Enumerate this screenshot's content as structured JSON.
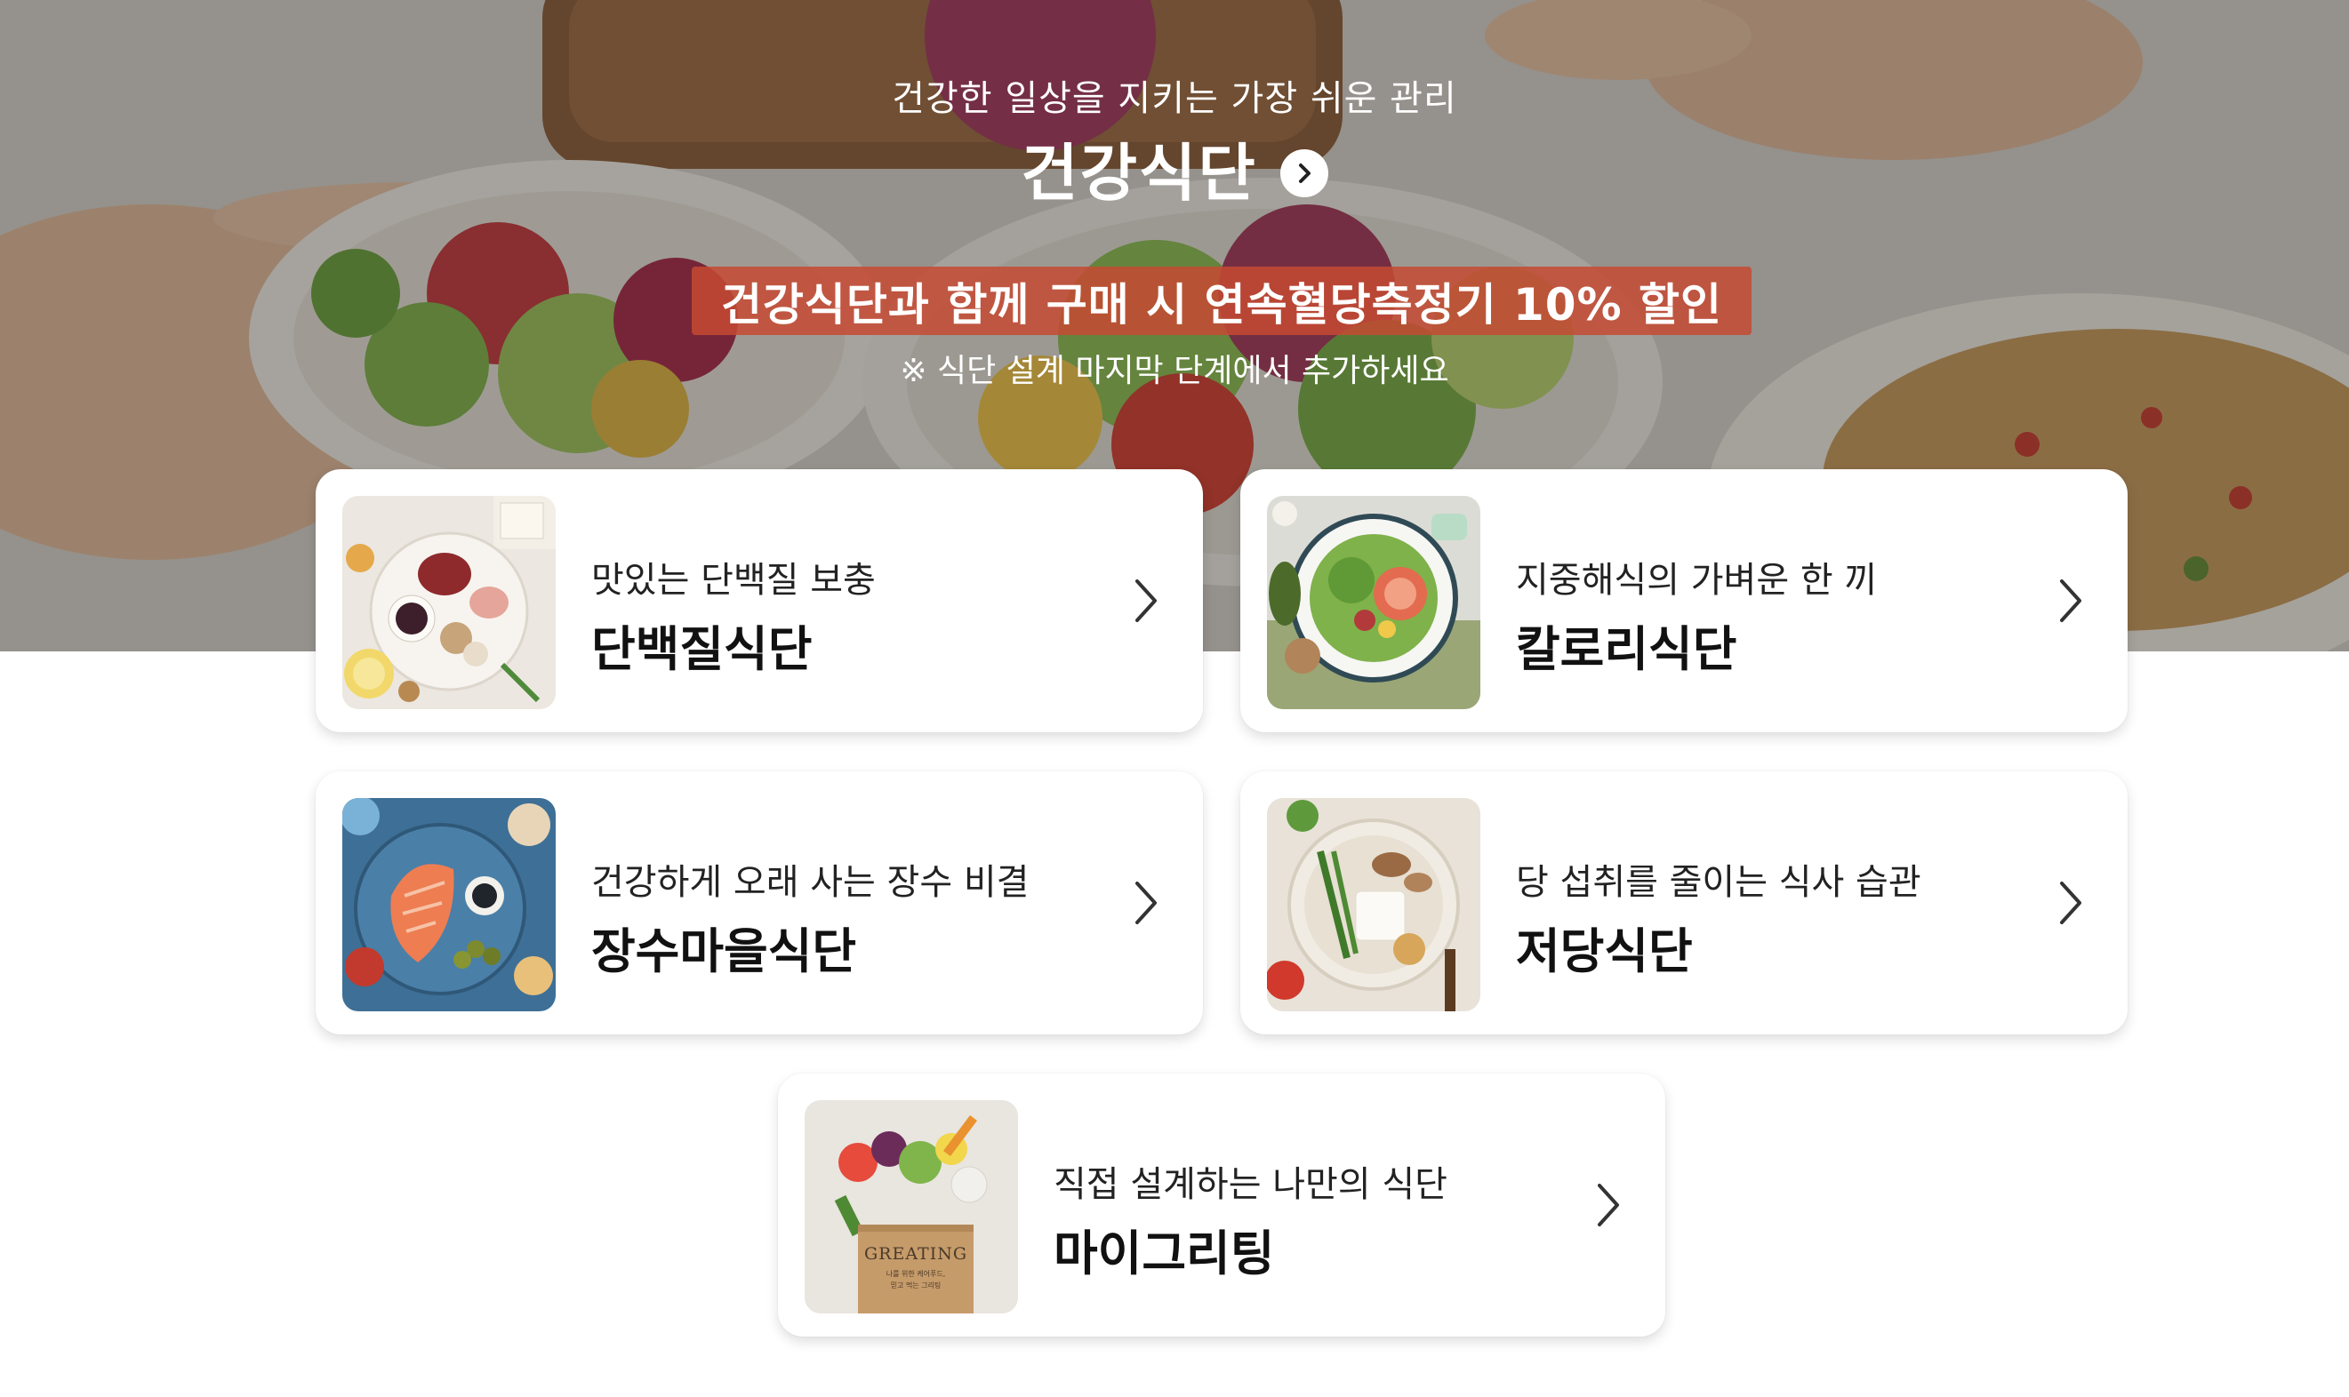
{
  "hero": {
    "subtitle": "건강한 일상을 지키는 가장 쉬운 관리",
    "title": "건강식단",
    "promo": "건강식단과 함께 구매 시 연속혈당측정기 10% 할인",
    "note": "※ 식단 설계 마지막 단계에서 추가하세요"
  },
  "cards": [
    {
      "subtitle": "맛있는 단백질 보충",
      "title": "단백질식단",
      "image": "protein-meal-plate"
    },
    {
      "subtitle": "지중해식의 가벼운 한 끼",
      "title": "칼로리식단",
      "image": "salad-bowl"
    },
    {
      "subtitle": "건강하게 오래 사는 장수 비결",
      "title": "장수마을식단",
      "image": "salmon-plate"
    },
    {
      "subtitle": "당 섭취를 줄이는 식사 습관",
      "title": "저당식단",
      "image": "tofu-vegetable-plate"
    },
    {
      "subtitle": "직접 설계하는 나만의 식단",
      "title": "마이그리팅",
      "image": "grocery-bag",
      "bag_brand": "GREATING",
      "bag_caption_1": "나를 위한 케어푸드,",
      "bag_caption_2": "믿고 먹는 그리팅"
    }
  ],
  "colors": {
    "promo_bg": "#c64a32",
    "card_bg": "#ffffff",
    "text_dark": "#111111"
  },
  "icons": {
    "title_button": "chevron-right-circle-icon",
    "card_arrow": "chevron-right-icon"
  }
}
